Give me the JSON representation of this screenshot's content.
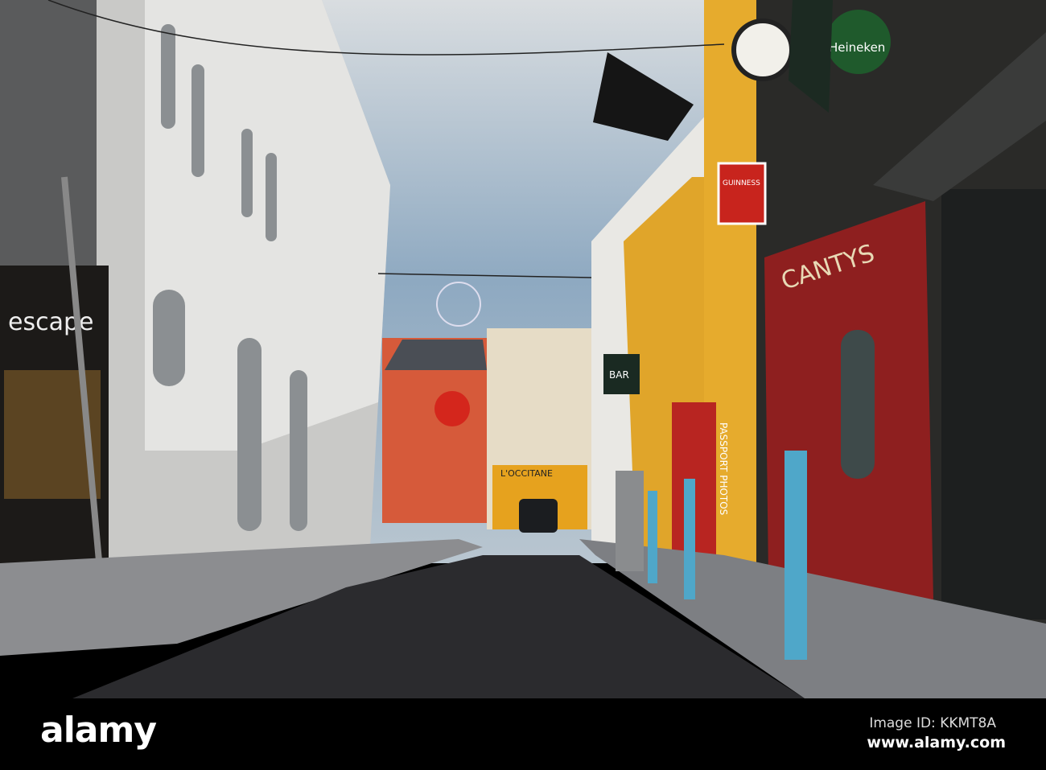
{
  "photo": {
    "description_signs": {
      "left_sign": "escape",
      "center_shop": "L'OCCITANE",
      "pub_sign": "CANTYS",
      "beer_sign": "Heineken",
      "guinness_sign": "GUINNESS",
      "passport": "PASSPORT PHOTOS",
      "bar_sign": "BAR"
    }
  },
  "watermark": {
    "logo": "alamy",
    "image_id": "Image ID: KKMT8A",
    "site": "www.alamy.com"
  },
  "colors": {
    "sky": "#9fb6c9",
    "road": "#2b2b2e",
    "pub_red": "#8e1f1f",
    "yellow": "#e0a52a"
  }
}
